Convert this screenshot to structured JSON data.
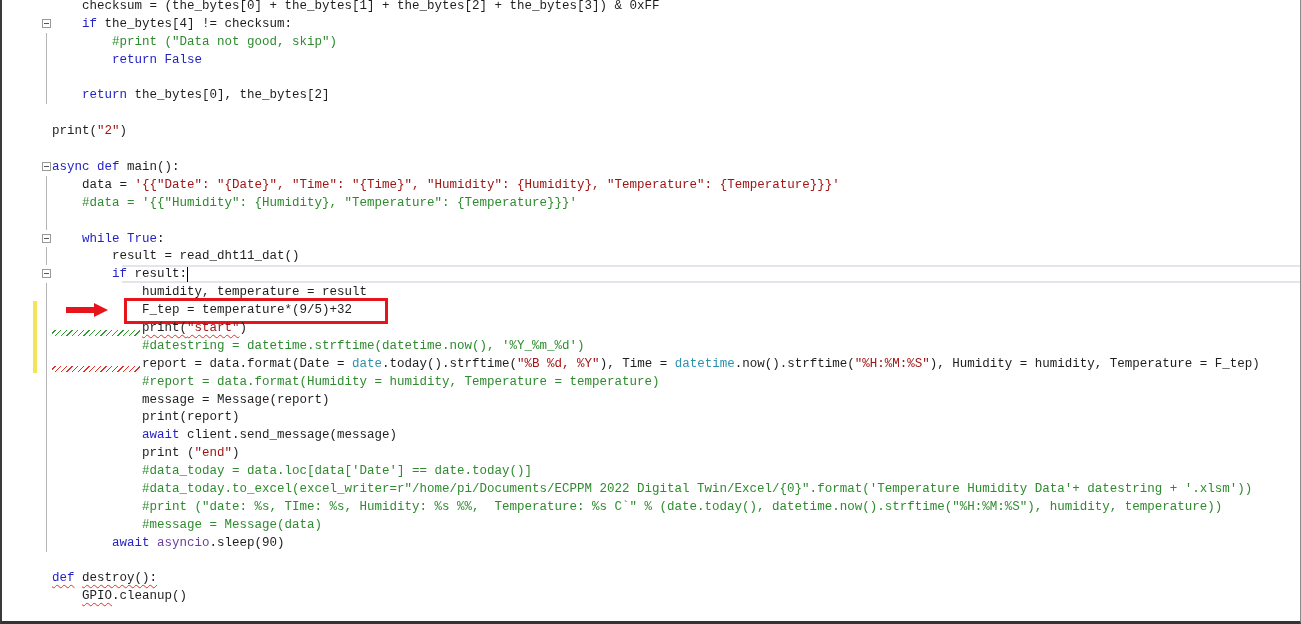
{
  "editor": {
    "lines": [
      {
        "tokens": [
          {
            "kind": "txt",
            "text": "    checksum = (the_bytes[0] + the_bytes[1] + the_bytes[2] + the_bytes[3]) & 0xFF"
          }
        ]
      },
      {
        "fold": true,
        "tokens": [
          {
            "kind": "kw",
            "text": "    if"
          },
          {
            "kind": "txt",
            "text": " the_bytes[4] != checksum:"
          }
        ]
      },
      {
        "guide": true,
        "tokens": [
          {
            "kind": "com",
            "text": "        #print (\"Data not good, skip\")"
          }
        ]
      },
      {
        "guide": true,
        "tokens": [
          {
            "kind": "kw",
            "text": "        return False"
          }
        ]
      },
      {
        "guide": true
      },
      {
        "guide": true,
        "tokens": [
          {
            "kind": "kw",
            "text": "    return"
          },
          {
            "kind": "txt",
            "text": " the_bytes[0], the_bytes[2]"
          }
        ]
      },
      {
        "guide": false
      },
      {
        "tokens": [
          {
            "kind": "txt",
            "text": "print("
          },
          {
            "kind": "str",
            "text": "\"2\""
          },
          {
            "kind": "txt",
            "text": ")"
          }
        ]
      },
      {
        "guide": false
      },
      {
        "fold": true,
        "tokens": [
          {
            "kind": "kw",
            "text": "async def"
          },
          {
            "kind": "txt",
            "text": " main():"
          }
        ]
      },
      {
        "guide": true,
        "tokens": [
          {
            "kind": "txt",
            "text": "    data = "
          },
          {
            "kind": "str",
            "text": "'{{\"Date\": \"{Date}\", \"Time\": \"{Time}\", \"Humidity\": {Humidity}, \"Temperature\": {Temperature}}}'"
          }
        ]
      },
      {
        "guide": true,
        "tokens": [
          {
            "kind": "com",
            "text": "    #data = '{{\"Humidity\": {Humidity}, \"Temperature\": {Temperature}}}'"
          }
        ]
      },
      {
        "guide": true
      },
      {
        "fold": true,
        "tokens": [
          {
            "kind": "kw",
            "text": "    while True"
          },
          {
            "kind": "txt",
            "text": ":"
          }
        ]
      },
      {
        "guide": true,
        "tokens": [
          {
            "kind": "txt",
            "text": "        result = read_dht11_dat()"
          }
        ]
      },
      {
        "fold": true,
        "current": true,
        "tokens": [
          {
            "kind": "kw",
            "text": "        if"
          },
          {
            "kind": "txt",
            "text": " result:"
          }
        ]
      },
      {
        "guide": true,
        "tokens": [
          {
            "kind": "txt",
            "text": "            humidity, temperature = result"
          }
        ]
      },
      {
        "guide": true,
        "changed": true,
        "marked": true,
        "tokens": [
          {
            "kind": "txt",
            "text": "            F_tep = temperature*(9/5)+32"
          }
        ]
      },
      {
        "guide": true,
        "changed": true,
        "lead_warning": true,
        "tokens": [
          {
            "kind": "txt",
            "error": true,
            "text": "            print("
          },
          {
            "kind": "str",
            "error": true,
            "text": "\"start\""
          },
          {
            "kind": "txt",
            "text": ")"
          }
        ]
      },
      {
        "guide": true,
        "changed": true,
        "tokens": [
          {
            "kind": "com",
            "text": "            #datestring = datetime.strftime(datetime.now(), '%Y_%m_%d')"
          }
        ]
      },
      {
        "guide": true,
        "changed": true,
        "lead_error": true,
        "tokens": [
          {
            "kind": "txt",
            "text": "            report = data.format(Date = "
          },
          {
            "kind": "cls",
            "text": "date"
          },
          {
            "kind": "txt",
            "text": ".today().strftime("
          },
          {
            "kind": "str",
            "text": "\"%B %d, %Y\""
          },
          {
            "kind": "txt",
            "text": "), Time = "
          },
          {
            "kind": "cls",
            "text": "datetime"
          },
          {
            "kind": "txt",
            "text": ".now().strftime("
          },
          {
            "kind": "str",
            "text": "\"%H:%M:%S\""
          },
          {
            "kind": "txt",
            "text": "), Humidity = humidity, Temperature = F_tep)"
          }
        ]
      },
      {
        "guide": true,
        "tokens": [
          {
            "kind": "com",
            "text": "            #report = data.format(Humidity = humidity, Temperature = temperature)"
          }
        ]
      },
      {
        "guide": true,
        "tokens": [
          {
            "kind": "txt",
            "text": "            message = Message(report)"
          }
        ]
      },
      {
        "guide": true,
        "tokens": [
          {
            "kind": "txt",
            "text": "            print(report)"
          }
        ]
      },
      {
        "guide": true,
        "tokens": [
          {
            "kind": "kw",
            "text": "            await"
          },
          {
            "kind": "txt",
            "text": " client.send_message(message)"
          }
        ]
      },
      {
        "guide": true,
        "tokens": [
          {
            "kind": "txt",
            "text": "            print ("
          },
          {
            "kind": "str",
            "text": "\"end\""
          },
          {
            "kind": "txt",
            "text": ")"
          }
        ]
      },
      {
        "guide": true,
        "tokens": [
          {
            "kind": "com",
            "text": "            #data_today = data.loc[data['Date'] == date.today()]"
          }
        ]
      },
      {
        "guide": true,
        "tokens": [
          {
            "kind": "com",
            "text": "            #data_today.to_excel(excel_writer=r\"/home/pi/Documents/ECPPM 2022 Digital Twin/Excel/{0}\".format('Temperature Humidity Data'+ datestring + '.xlsm'))"
          }
        ]
      },
      {
        "guide": true,
        "tokens": [
          {
            "kind": "com",
            "text": "            #print (\"date: %s, TIme: %s, Humidity: %s %%,  Temperature: %s C`\" % (date.today(), datetime.now().strftime(\"%H:%M:%S\"), humidity, temperature))"
          }
        ]
      },
      {
        "guide": true,
        "tokens": [
          {
            "kind": "com",
            "text": "            #message = Message(data)"
          }
        ]
      },
      {
        "guide": true,
        "tokens": [
          {
            "kind": "kw",
            "text": "        await"
          },
          {
            "kind": "mod",
            "text": " asyncio"
          },
          {
            "kind": "txt",
            "text": ".sleep(90)"
          }
        ]
      },
      {
        "guide": false
      },
      {
        "tokens": [
          {
            "kind": "kw",
            "error": true,
            "text": "def"
          },
          {
            "kind": "txt",
            "error": true,
            "text": " destroy():"
          }
        ]
      },
      {
        "tokens": [
          {
            "kind": "txt",
            "error": true,
            "text": "    GPIO"
          },
          {
            "kind": "txt",
            "text": ".cleanup()"
          }
        ]
      }
    ]
  }
}
